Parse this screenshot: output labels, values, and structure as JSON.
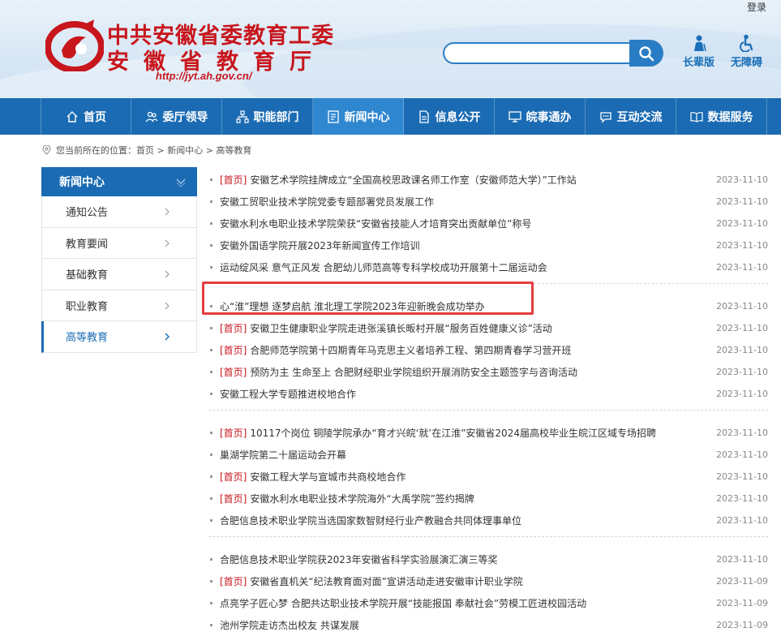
{
  "header": {
    "login": "登录",
    "logo_line1": "中共安徽省委教育工委",
    "logo_line2": "安徽省教育厅",
    "logo_url": "http://jyt.ah.gov.cn/",
    "search_placeholder": "",
    "tools": [
      {
        "label": "长辈版",
        "icon": "elder-icon"
      },
      {
        "label": "无障碍",
        "icon": "accessibility-icon"
      }
    ]
  },
  "nav": {
    "items": [
      {
        "label": "首页",
        "icon": "home-icon"
      },
      {
        "label": "委厅领导",
        "icon": "leaders-icon"
      },
      {
        "label": "职能部门",
        "icon": "org-chart-icon"
      },
      {
        "label": "新闻中心",
        "icon": "news-icon",
        "active": true
      },
      {
        "label": "信息公开",
        "icon": "document-icon"
      },
      {
        "label": "皖事通办",
        "icon": "monitor-icon"
      },
      {
        "label": "互动交流",
        "icon": "chat-icon"
      },
      {
        "label": "数据服务",
        "icon": "book-icon"
      }
    ]
  },
  "breadcrumb": {
    "prefix": "您当前所在的位置：",
    "path": "首页 > 新闻中心 > 高等教育"
  },
  "sidebar": {
    "title": "新闻中心",
    "items": [
      {
        "label": "通知公告"
      },
      {
        "label": "教育要闻"
      },
      {
        "label": "基础教育"
      },
      {
        "label": "职业教育"
      },
      {
        "label": "高等教育",
        "active": true
      }
    ]
  },
  "news": {
    "tag_label": "[首页]",
    "groups": [
      [
        {
          "tag": true,
          "title": "安徽艺术学院挂牌成立“全国高校思政课名师工作室（安徽师范大学）”工作站",
          "date": "2023-11-10"
        },
        {
          "tag": false,
          "title": "安徽工贸职业技术学院党委专题部署党员发展工作",
          "date": "2023-11-10"
        },
        {
          "tag": false,
          "title": "安徽水利水电职业技术学院荣获“安徽省技能人才培育突出贡献单位”称号",
          "date": "2023-11-10"
        },
        {
          "tag": false,
          "title": "安徽外国语学院开展2023年新闻宣传工作培训",
          "date": "2023-11-10"
        },
        {
          "tag": false,
          "title": "运动绽风采 意气正风发 合肥幼儿师范高等专科学校成功开展第十二届运动会",
          "date": "2023-11-10"
        }
      ],
      [
        {
          "tag": false,
          "title": "心“淮”理想 逐梦启航 淮北理工学院2023年迎新晚会成功举办",
          "date": "2023-11-10"
        },
        {
          "tag": true,
          "title": "安徽卫生健康职业学院走进张溪镇长畈村开展“服务百姓健康义诊”活动",
          "date": "2023-11-10"
        },
        {
          "tag": true,
          "title": "合肥师范学院第十四期青年马克思主义者培养工程、第四期青春学习营开班",
          "date": "2023-11-10"
        },
        {
          "tag": true,
          "title": "预防为主 生命至上 合肥财经职业学院组织开展消防安全主题签字与咨询活动",
          "date": "2023-11-10"
        },
        {
          "tag": false,
          "title": "安徽工程大学专题推进校地合作",
          "date": "2023-11-10"
        }
      ],
      [
        {
          "tag": true,
          "title": "10117个岗位 铜陵学院承办“育才兴皖‘就’在江淮”安徽省2024届高校毕业生皖江区域专场招聘",
          "date": "2023-11-10"
        },
        {
          "tag": false,
          "title": "巢湖学院第二十届运动会开幕",
          "date": "2023-11-10"
        },
        {
          "tag": true,
          "title": "安徽工程大学与宣城市共商校地合作",
          "date": "2023-11-10"
        },
        {
          "tag": true,
          "title": "安徽水利水电职业技术学院海外“大禹学院”签约揭牌",
          "date": "2023-11-10"
        },
        {
          "tag": false,
          "title": "合肥信息技术职业学院当选国家数智财经行业产教融合共同体理事单位",
          "date": "2023-11-10"
        }
      ],
      [
        {
          "tag": false,
          "title": "合肥信息技术职业学院获2023年安徽省科学实验展演汇演三等奖",
          "date": "2023-11-10"
        },
        {
          "tag": true,
          "title": "安徽省直机关“纪法教育面对面”宣讲活动走进安徽审计职业学院",
          "date": "2023-11-09"
        },
        {
          "tag": false,
          "title": "点亮学子匠心梦 合肥共达职业技术学院开展“技能报国 奉献社会”劳模工匠进校园活动",
          "date": "2023-11-09"
        },
        {
          "tag": false,
          "title": "池州学院走访杰出校友 共谋发展",
          "date": "2023-11-09"
        }
      ]
    ]
  },
  "colors": {
    "brand_red": "#c8161d",
    "nav_blue": "#1a6bb3",
    "nav_active": "#2f87d0",
    "highlight_red": "#e53d3d"
  }
}
